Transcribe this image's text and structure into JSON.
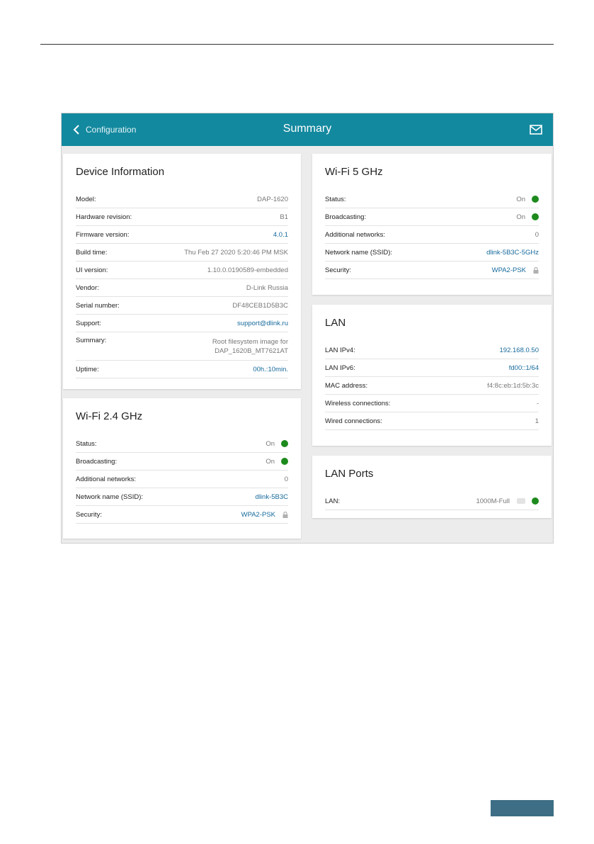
{
  "header": {
    "back_label": "Configuration",
    "title": "Summary",
    "accent_color": "#13899f"
  },
  "device_info": {
    "title": "Device Information",
    "rows": [
      {
        "label": "Model:",
        "value": "DAP-1620"
      },
      {
        "label": "Hardware revision:",
        "value": "B1"
      },
      {
        "label": "Firmware version:",
        "value": "4.0.1"
      },
      {
        "label": "Build time:",
        "value": "Thu Feb 27 2020 5:20:46 PM MSK"
      },
      {
        "label": "UI version:",
        "value": "1.10.0.0190589-embedded"
      },
      {
        "label": "Vendor:",
        "value": "D-Link Russia"
      },
      {
        "label": "Serial number:",
        "value": "DF48CEB1D5B3C"
      },
      {
        "label": "Support:",
        "value": "support@dlink.ru"
      },
      {
        "label": "Summary:",
        "value_line1": "Root filesystem image for",
        "value_line2": "DAP_1620B_MT7621AT"
      },
      {
        "label": "Uptime:",
        "value": "00h.:10min."
      }
    ]
  },
  "wifi24": {
    "title": "Wi-Fi 2.4 GHz",
    "rows": [
      {
        "label": "Status:",
        "value": "On"
      },
      {
        "label": "Broadcasting:",
        "value": "On"
      },
      {
        "label": "Additional networks:",
        "value": "0"
      },
      {
        "label": "Network name (SSID):",
        "value": "dlink-5B3C"
      },
      {
        "label": "Security:",
        "value": "WPA2-PSK"
      }
    ]
  },
  "wifi5": {
    "title": "Wi-Fi 5 GHz",
    "rows": [
      {
        "label": "Status:",
        "value": "On"
      },
      {
        "label": "Broadcasting:",
        "value": "On"
      },
      {
        "label": "Additional networks:",
        "value": "0"
      },
      {
        "label": "Network name (SSID):",
        "value": "dlink-5B3C-5GHz"
      },
      {
        "label": "Security:",
        "value": "WPA2-PSK"
      }
    ]
  },
  "lan": {
    "title": "LAN",
    "rows": [
      {
        "label": "LAN IPv4:",
        "value": "192.168.0.50"
      },
      {
        "label": "LAN IPv6:",
        "value": "fd00::1/64"
      },
      {
        "label": "MAC address:",
        "value": "f4:8c:eb:1d:5b:3c"
      },
      {
        "label": "Wireless connections:",
        "value": "-"
      },
      {
        "label": "Wired connections:",
        "value": "1"
      }
    ]
  },
  "lan_ports": {
    "title": "LAN Ports",
    "rows": [
      {
        "label": "LAN:",
        "value": "1000M-Full"
      }
    ]
  },
  "icons": {
    "back": "chevron-left-icon",
    "mail": "mail-icon",
    "status": "status-dot-icon",
    "lock": "lock-icon"
  },
  "status_color": "#1d8a1d"
}
